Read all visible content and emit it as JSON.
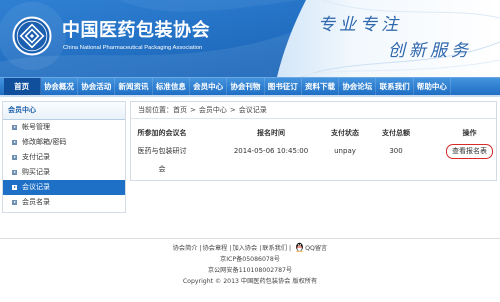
{
  "header": {
    "logo_icon": "association-logo-icon",
    "title": "中国医药包装协会",
    "subtitle": "China National Pharmaceutical Packaging Association",
    "slogan": [
      "专业专注",
      "创新服务"
    ]
  },
  "nav": {
    "items": [
      {
        "label": "首页",
        "active": true
      },
      {
        "label": "协会概况",
        "active": false
      },
      {
        "label": "协会活动",
        "active": false
      },
      {
        "label": "新闻资讯",
        "active": false
      },
      {
        "label": "标准信息",
        "active": false
      },
      {
        "label": "会员中心",
        "active": false
      },
      {
        "label": "协会刊物",
        "active": false
      },
      {
        "label": "图书征订",
        "active": false
      },
      {
        "label": "资料下载",
        "active": false
      },
      {
        "label": "协会论坛",
        "active": false
      },
      {
        "label": "联系我们",
        "active": false
      },
      {
        "label": "帮助中心",
        "active": false
      }
    ]
  },
  "sidebar": {
    "title": "会员中心",
    "bullet_icon": "square-bullet-icon",
    "items": [
      {
        "label": "帐号管理",
        "active": false
      },
      {
        "label": "修改邮箱/密码",
        "active": false
      },
      {
        "label": "支付记录",
        "active": false
      },
      {
        "label": "购买记录",
        "active": false
      },
      {
        "label": "会议记录",
        "active": true
      },
      {
        "label": "会员名录",
        "active": false
      }
    ]
  },
  "breadcrumb": {
    "label": "当前位置：",
    "items": [
      "首页",
      "会员中心",
      "会议记录"
    ],
    "separator": ">"
  },
  "records_table": {
    "columns": [
      "所参加的会议名",
      "报名时间",
      "支付状态",
      "支付总额",
      "操作"
    ],
    "rows": [
      {
        "meeting_name": "医药与包装研讨会",
        "registered_at": "2014-05-06 10:45:00",
        "payment_status": "unpay",
        "payment_total": "300",
        "action": "查看报名表"
      }
    ]
  },
  "footer": {
    "links": [
      "协会简介",
      "协会章程",
      "加入协会",
      "联系我们"
    ],
    "separator": "|",
    "qq_icon": "qq-penguin-icon",
    "qq_label": "QQ留言",
    "icp": "京ICP备05086078号",
    "police_record": "京公网安备110108002787号",
    "copyright": "Copyright © 2013 中国医药包装协会 版权所有"
  },
  "colors": {
    "nav_blue": "#1f6ec4",
    "nav_active": "#0f4f9c",
    "sidebar_active": "#1e6fc6",
    "sidebar_title": "#1b5ea8",
    "slogan": "#2f67ad",
    "highlight_red": "#d42a2a"
  }
}
